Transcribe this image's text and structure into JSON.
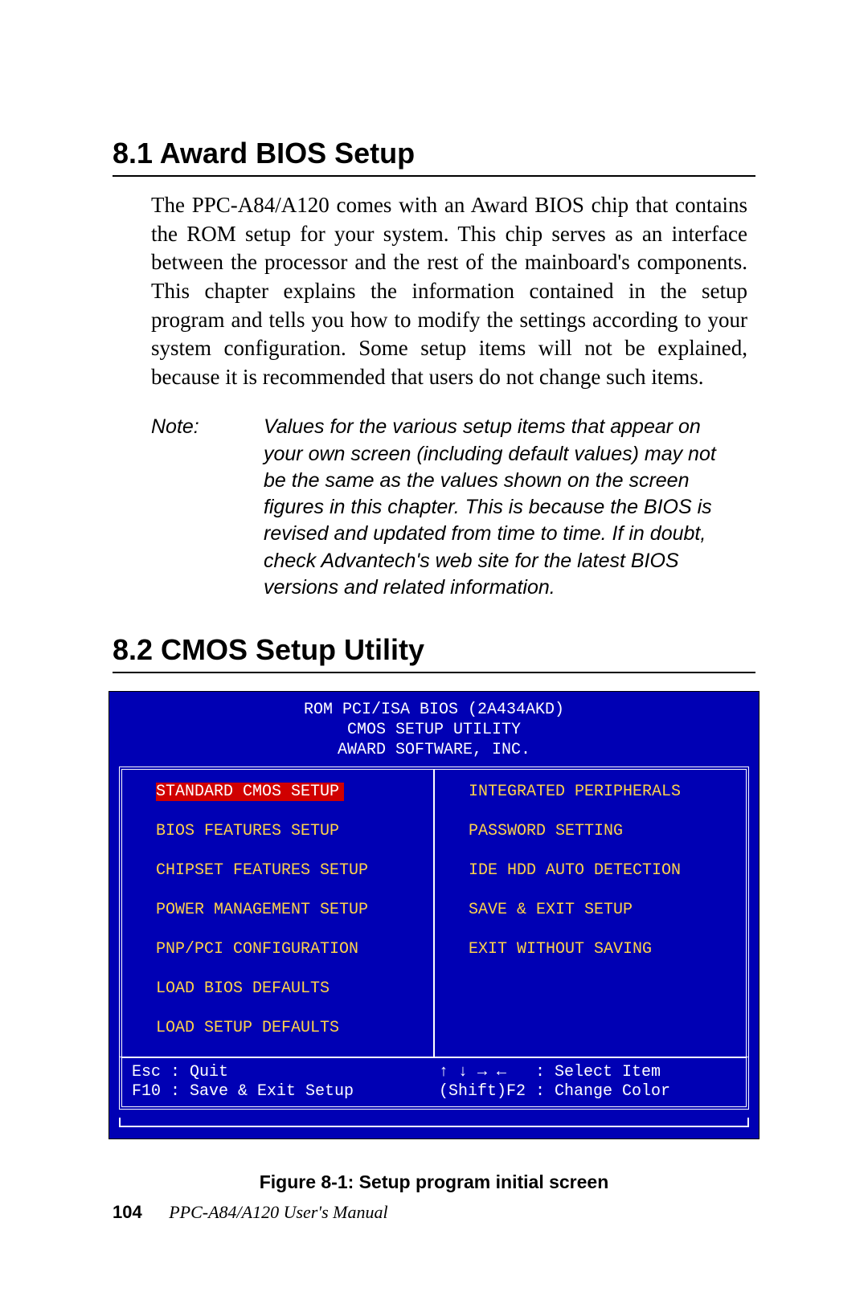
{
  "section1": {
    "heading": "8.1  Award BIOS Setup",
    "body": "The PPC-A84/A120 comes with an Award BIOS chip that contains the ROM setup for your system. This chip serves as an interface between the processor and the rest of the mainboard's components. This chapter explains the information contained in the setup program and tells you how to modify the settings according to your system configuration. Some setup items will not be explained, because it is recommended that users do not change such items.",
    "note_label": "Note:",
    "note_body": "Values for the various setup items that appear on your own screen (including default values) may not be the same as the values shown on the screen figures in this chapter. This is because the BIOS is revised and updated from time to time. If in doubt, check Advantech's web site for the latest BIOS versions and related information."
  },
  "section2": {
    "heading": "8.2  CMOS Setup Utility"
  },
  "bios": {
    "header_line1": "ROM PCI/ISA BIOS (2A434AKD)",
    "header_line2": "CMOS SETUP UTILITY",
    "header_line3": "AWARD SOFTWARE, INC.",
    "left_menu": [
      "STANDARD CMOS SETUP",
      "BIOS FEATURES SETUP",
      "CHIPSET FEATURES SETUP",
      "POWER MANAGEMENT SETUP",
      "PNP/PCI CONFIGURATION",
      "LOAD BIOS DEFAULTS",
      "LOAD SETUP DEFAULTS"
    ],
    "right_menu": [
      "INTEGRATED PERIPHERALS",
      "PASSWORD SETTING",
      "IDE HDD AUTO DETECTION",
      "SAVE & EXIT SETUP",
      "EXIT WITHOUT SAVING"
    ],
    "selected_index": 0,
    "footer_left": "Esc : Quit\nF10 : Save & Exit Setup",
    "footer_right": "↑ ↓ → ←   : Select Item\n(Shift)F2 : Change Color"
  },
  "figure_caption": "Figure 8-1: Setup program initial screen",
  "footer": {
    "page_number": "104",
    "doc_title": "PPC-A84/A120  User's Manual"
  }
}
